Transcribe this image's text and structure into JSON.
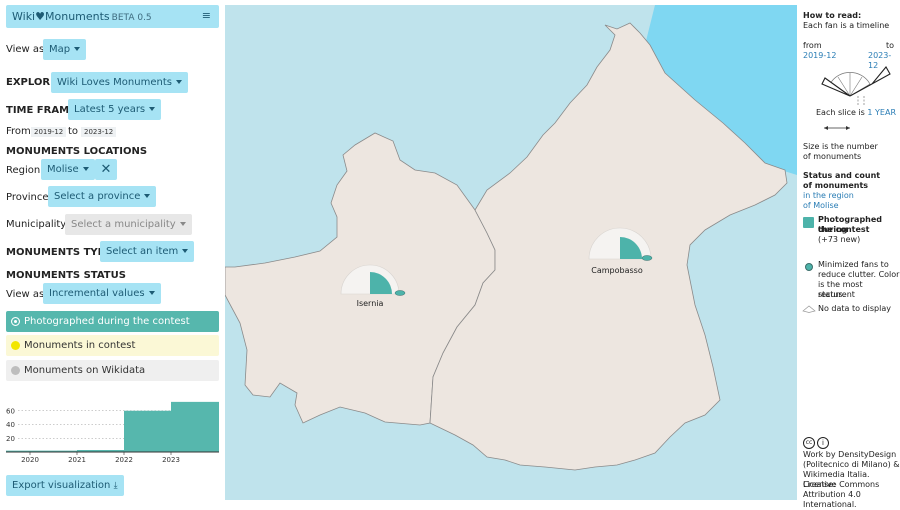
{
  "app": {
    "title": "Wiki",
    "heart": "♥",
    "title2": "Monuments",
    "beta": "BETA 0.5",
    "menu_icon": "hamburger-menu-icon"
  },
  "view_as": {
    "label": "View as",
    "value": "Map"
  },
  "explore": {
    "label": "EXPLORE",
    "value": "Wiki Loves Monuments"
  },
  "time_frame": {
    "label": "TIME FRAME",
    "value": "Latest 5 years",
    "from_label": "From",
    "from_value": "2019-12",
    "to_label": "to",
    "to_value": "2023-12"
  },
  "locations": {
    "heading": "MONUMENTS LOCATIONS",
    "region_label": "Region",
    "region_value": "Molise",
    "province_label": "Province",
    "province_placeholder": "Select a province",
    "municipality_label": "Municipality",
    "municipality_placeholder": "Select a municipality"
  },
  "type": {
    "label": "MONUMENTS TYPE",
    "value": "Select an item"
  },
  "status": {
    "heading": "MONUMENTS STATUS",
    "view_label": "View as",
    "view_value": "Incremental values",
    "items": [
      {
        "label": "Photographed during the contest",
        "color": "#4db3aa"
      },
      {
        "label": "Monuments in contest",
        "color": "#f2e600"
      },
      {
        "label": "Monuments on Wikidata",
        "color": "#bdbdbd"
      }
    ]
  },
  "chart_data": {
    "type": "area",
    "x": [
      "2020",
      "2021",
      "2022",
      "2023"
    ],
    "y_ticks": [
      "60",
      "40",
      "20"
    ],
    "values": [
      2,
      3,
      60,
      73
    ],
    "ylim": [
      0,
      80
    ]
  },
  "export": {
    "label": "Export visualization"
  },
  "map": {
    "places": [
      {
        "name": "Isernia"
      },
      {
        "name": "Campobasso"
      }
    ],
    "colors": {
      "sea": "#bfe3ec",
      "land": "#ede6e0",
      "adriatic": "#7fd7f2",
      "fan": "#4db3aa"
    }
  },
  "legend": {
    "how_to_read": "How to read:",
    "each_fan": "Each fan is a timeline",
    "from_label": "from",
    "from_value": "2019-12",
    "to_label": "to",
    "to_value": "2023-12",
    "slice_text": "Each slice is",
    "slice_value": "1 YEAR",
    "size_text_1": "Size is the number",
    "size_text_2": "of monuments",
    "status_title_1": "Status and count",
    "status_title_2": "of monuments",
    "region_line_1": "in the region",
    "region_line_2": "of Molise",
    "photographed_1": "Photographed during",
    "photographed_2": "the contest",
    "photographed_new": "(+73 new)",
    "minimized_1": "Minimized fans to",
    "minimized_2": "reduce clutter. Color",
    "minimized_3": "is the most recurrent",
    "minimized_4": "status.",
    "no_data": "No data to display",
    "credits_1": "Work by DensityDesign",
    "credits_2": "(Politecnico di Milano) &",
    "credits_3": "Wikimedia Italia. License:",
    "credits_4": "Creative Commons",
    "credits_5": "Attribution 4.0 International."
  }
}
